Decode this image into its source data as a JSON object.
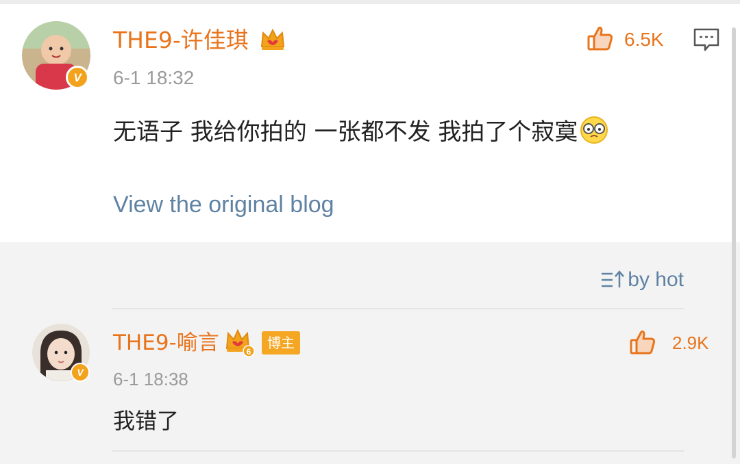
{
  "post": {
    "username": "THE9-许佳琪",
    "time": "6-1 18:32",
    "content": "无语子 我给你拍的 一张都不发 我拍了个寂寞",
    "like_count": "6.5K",
    "view_original": "View the original blog",
    "verified_mark": "V"
  },
  "comments_section": {
    "sort_label": "by hot",
    "comments": [
      {
        "username": "THE9-喻言",
        "badge": "博主",
        "level": "6",
        "time": "6-1 18:38",
        "content": "我错了",
        "like_count": "2.9K",
        "verified_mark": "V"
      }
    ]
  },
  "colors": {
    "username": "#e8741c",
    "link": "#5f82a3",
    "crown": "#f3a21b",
    "badge_bg": "#f5a623"
  }
}
